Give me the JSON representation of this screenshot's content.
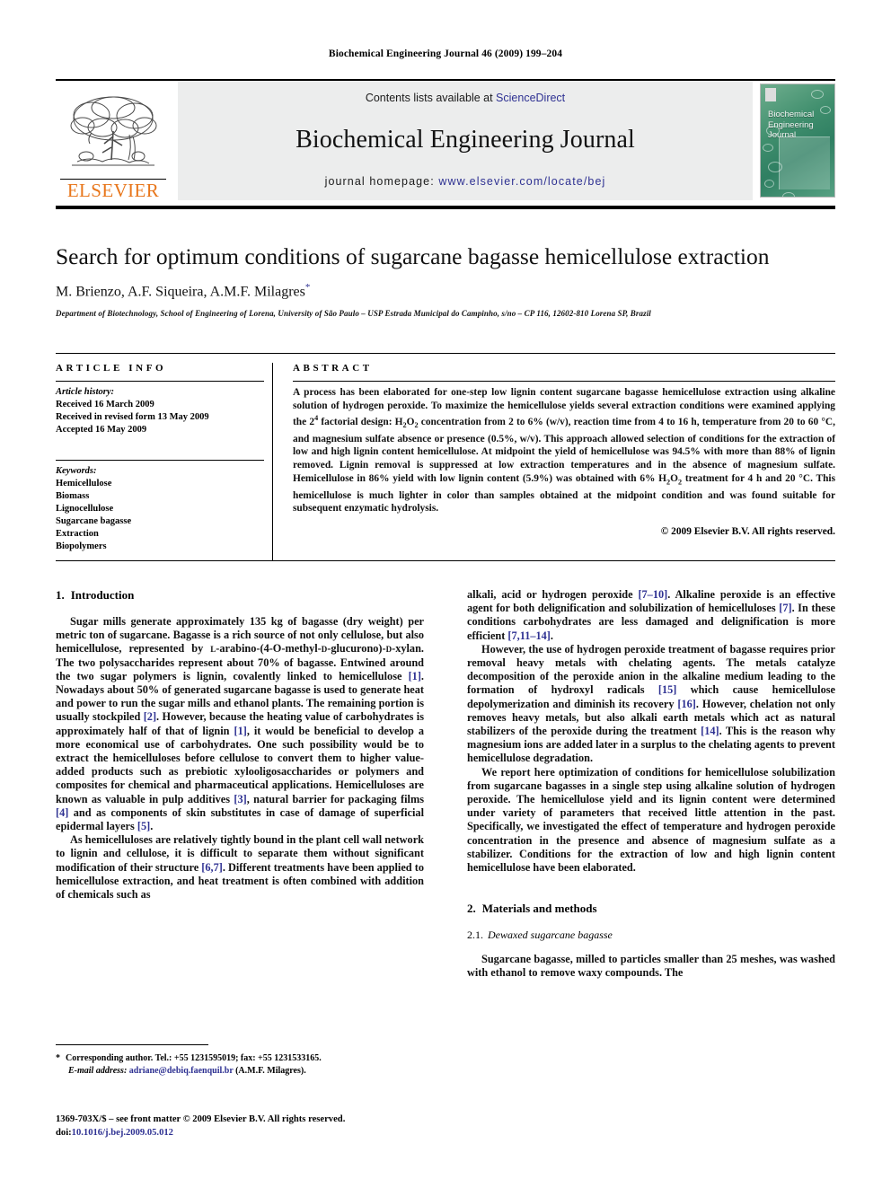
{
  "running_head": "Biochemical Engineering Journal 46 (2009) 199–204",
  "masthead": {
    "contents_prefix": "Contents lists available at ",
    "sciencedirect": "ScienceDirect",
    "journal_name": "Biochemical Engineering Journal",
    "homepage_prefix": "journal homepage: ",
    "homepage_url": "www.elsevier.com/locate/bej",
    "publisher": "ELSEVIER",
    "cover_title_lines": [
      "Biochemical",
      "Engineering",
      "Journal"
    ],
    "colors": {
      "link": "#2e3192",
      "elsevier_orange": "#e8761b",
      "band_gray": "#eceded",
      "cover_green": "#3f8e6d"
    }
  },
  "article": {
    "title": "Search for optimum conditions of sugarcane bagasse hemicellulose extraction",
    "authors": "M. Brienzo, A.F. Siqueira, A.M.F. Milagres",
    "corresponding_marker": "*",
    "affiliation": "Department of Biotechnology, School of Engineering of Lorena, University of São Paulo – USP Estrada Municipal do Campinho, s/no – CP 116, 12602-810 Lorena SP, Brazil"
  },
  "info": {
    "heading": "ARTICLE INFO",
    "history_title": "Article history:",
    "history": [
      "Received 16 March 2009",
      "Received in revised form 13 May 2009",
      "Accepted 16 May 2009"
    ],
    "keywords_title": "Keywords:",
    "keywords": [
      "Hemicellulose",
      "Biomass",
      "Lignocellulose",
      "Sugarcane bagasse",
      "Extraction",
      "Biopolymers"
    ]
  },
  "abstract": {
    "heading": "ABSTRACT",
    "part1": "A process has been elaborated for one-step low lignin content sugarcane bagasse hemicellulose extraction using alkaline solution of hydrogen peroxide. To maximize the hemicellulose yields several extraction conditions were examined applying the 2",
    "sup1": "4",
    "part2": " factorial design: H",
    "sub1": "2",
    "part3": "O",
    "sub2": "2",
    "part4": " concentration from 2 to 6% (w/v), reaction time from 4 to 16 h, temperature from 20 to 60 °C, and magnesium sulfate absence or presence (0.5%, w/v). This approach allowed selection of conditions for the extraction of low and high lignin content hemicellulose. At midpoint the yield of hemicellulose was 94.5% with more than 88% of lignin removed. Lignin removal is suppressed at low extraction temperatures and in the absence of magnesium sulfate. Hemicellulose in 86% yield with low lignin content (5.9%) was obtained with 6% H",
    "sub3": "2",
    "part5": "O",
    "sub4": "2",
    "part6": " treatment for 4 h and 20 °C. This hemicellulose is much lighter in color than samples obtained at the midpoint condition and was found suitable for subsequent enzymatic hydrolysis.",
    "copyright": "© 2009 Elsevier B.V. All rights reserved."
  },
  "sections": {
    "intro": {
      "num": "1.",
      "title": "Introduction"
    },
    "methods": {
      "num": "2.",
      "title": "Materials and methods"
    },
    "methods_sub": {
      "num": "2.1.",
      "title": "Dewaxed sugarcane bagasse"
    }
  },
  "left_column": {
    "p1_a": "Sugar mills generate approximately 135 kg of bagasse (dry weight) per metric ton of sugarcane. Bagasse is a rich source of not only cellulose, but also hemicellulose, represented by ",
    "p1_sc1": "l",
    "p1_b": "-arabino-(4-O-methyl-",
    "p1_sc2": "d",
    "p1_c": "-glucurono)-",
    "p1_sc3": "d",
    "p1_d": "-xylan. The two polysaccharides represent about 70% of bagasse. Entwined around the two sugar polymers is lignin, covalently linked to hemicellulose ",
    "p1_r1": "[1]",
    "p1_e": ". Nowadays about 50% of generated sugarcane bagasse is used to generate heat and power to run the sugar mills and ethanol plants. The remaining portion is usually stockpiled ",
    "p1_r2": "[2]",
    "p1_f": ". However, because the heating value of carbohydrates is approximately half of that of lignin ",
    "p1_r3": "[1]",
    "p1_g": ", it would be beneficial to develop a more economical use of carbohydrates. One such possibility would be to extract the hemicelluloses before cellulose to convert them to higher value-added products such as prebiotic xylooligosaccharides or polymers and composites for chemical and pharmaceutical applications. Hemicelluloses are known as valuable in pulp additives ",
    "p1_r4": "[3]",
    "p1_h": ", natural barrier for packaging films ",
    "p1_r5": "[4]",
    "p1_i": " and as components of skin substitutes in case of damage of superficial epidermal layers ",
    "p1_r6": "[5]",
    "p1_j": ".",
    "p2_a": "As hemicelluloses are relatively tightly bound in the plant cell wall network to lignin and cellulose, it is difficult to separate them without significant modification of their structure ",
    "p2_r1": "[6,7]",
    "p2_b": ". Different treatments have been applied to hemicellulose extraction, and heat treatment is often combined with addition of chemicals such as"
  },
  "right_column": {
    "p1_a": "alkali, acid or hydrogen peroxide ",
    "p1_r1": "[7–10]",
    "p1_b": ". Alkaline peroxide is an effective agent for both delignification and solubilization of hemicelluloses ",
    "p1_r2": "[7]",
    "p1_c": ". In these conditions carbohydrates are less damaged and delignification is more efficient ",
    "p1_r3": "[7,11–14]",
    "p1_d": ".",
    "p2_a": "However, the use of hydrogen peroxide treatment of bagasse requires prior removal heavy metals with chelating agents. The metals catalyze decomposition of the peroxide anion in the alkaline medium leading to the formation of hydroxyl radicals ",
    "p2_r1": "[15]",
    "p2_b": " which cause hemicellulose depolymerization and diminish its recovery ",
    "p2_r2": "[16]",
    "p2_c": ". However, chelation not only removes heavy metals, but also alkali earth metals which act as natural stabilizers of the peroxide during the treatment ",
    "p2_r3": "[14]",
    "p2_d": ". This is the reason why magnesium ions are added later in a surplus to the chelating agents to prevent hemicellulose degradation.",
    "p3": "We report here optimization of conditions for hemicellulose solubilization from sugarcane bagasses in a single step using alkaline solution of hydrogen peroxide. The hemicellulose yield and its lignin content were determined under variety of parameters that received little attention in the past. Specifically, we investigated the effect of temperature and hydrogen peroxide concentration in the presence and absence of magnesium sulfate as a stabilizer. Conditions for the extraction of low and high lignin content hemicellulose have been elaborated.",
    "p4": "Sugarcane bagasse, milled to particles smaller than 25 meshes, was washed with ethanol to remove waxy compounds. The"
  },
  "footnote": {
    "star": "*",
    "corresponding": "Corresponding author. Tel.: +55 1231595019; fax: +55 1231533165.",
    "email_label": "E-mail address:",
    "email": "adriane@debiq.faenquil.br",
    "email_suffix": " (A.M.F. Milagres)."
  },
  "imprint": {
    "line1": "1369-703X/$ – see front matter © 2009 Elsevier B.V. All rights reserved.",
    "doi_label": "doi:",
    "doi": "10.1016/j.bej.2009.05.012"
  }
}
